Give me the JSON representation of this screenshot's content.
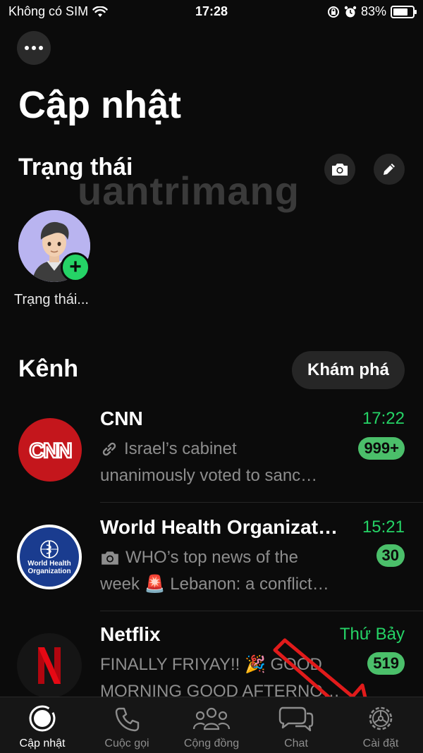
{
  "status_bar": {
    "carrier": "Không có SIM",
    "time": "17:28",
    "battery": "83%"
  },
  "header": {
    "title": "Cập nhật"
  },
  "status_section": {
    "title": "Trạng thái",
    "my_status_label": "Trạng thái..."
  },
  "watermark": "uantrimang",
  "channels_section": {
    "title": "Kênh",
    "explore_label": "Khám phá",
    "channels": [
      {
        "name": "CNN",
        "time": "17:22",
        "unread": "999+",
        "message_line1": "Israel’s cabinet",
        "message_line2": "unanimously voted to sanc…",
        "icon": "link-icon"
      },
      {
        "name": "World Health Organizat…",
        "time": "15:21",
        "unread": "30",
        "message_line1": "WHO’s top news of the",
        "message_line2": "week 🚨 Lebanon: a conflict…",
        "icon": "camera-icon",
        "logo_text_1": "World Health",
        "logo_text_2": "Organization"
      },
      {
        "name": "Netflix",
        "time": "Thứ Bảy",
        "unread": "519",
        "message_line1": "FINALLY FRIYAY!! 🎉 GOOD",
        "message_line2": "MORNING GOOD AFTERNO…"
      }
    ]
  },
  "tabs": [
    {
      "label": "Cập nhật",
      "icon": "updates-icon",
      "active": true
    },
    {
      "label": "Cuộc gọi",
      "icon": "phone-icon"
    },
    {
      "label": "Cộng đồng",
      "icon": "community-icon"
    },
    {
      "label": "Chat",
      "icon": "chat-icon"
    },
    {
      "label": "Cài đặt",
      "icon": "settings-icon"
    }
  ],
  "colors": {
    "background": "#0b0b0b",
    "accent_green": "#25d366",
    "cnn_red": "#c4161c",
    "who_blue": "#1a3c8f",
    "arrow_red": "#e11b1b"
  }
}
